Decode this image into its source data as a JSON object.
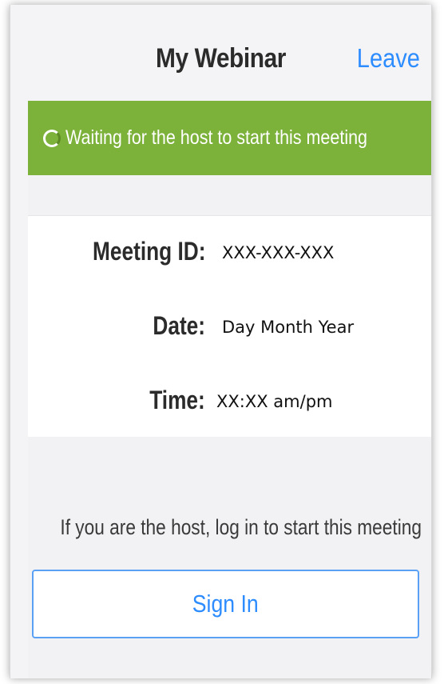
{
  "header": {
    "title": "My Webinar",
    "leave_label": "Leave"
  },
  "status_banner": {
    "message": "Waiting for the host to start this meeting",
    "color": "#7cb13a"
  },
  "meeting_details": [
    {
      "label": "Meeting ID:",
      "value": "XXX-XXX-XXX"
    },
    {
      "label": "Date:",
      "value": "Day Month Year"
    },
    {
      "label": "Time:",
      "value": "XX:XX am/pm"
    }
  ],
  "footer": {
    "host_prompt": "If you are the host, log in to start this meeting",
    "sign_in_label": "Sign In"
  },
  "colors": {
    "accent": "#2d8cff",
    "banner": "#7cb13a",
    "background": "#f2f2f4"
  }
}
